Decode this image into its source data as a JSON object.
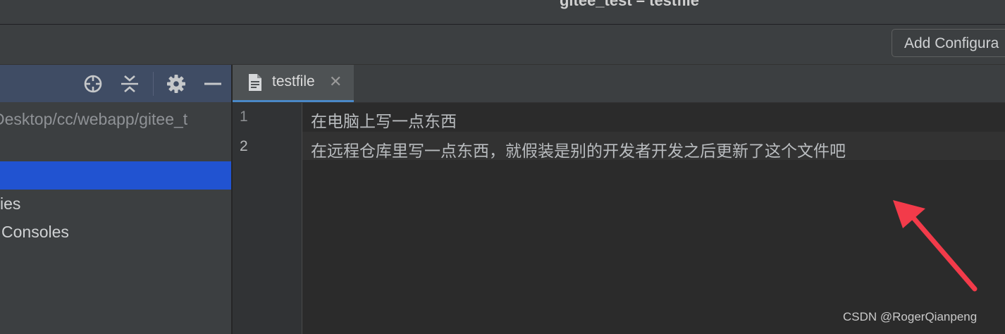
{
  "window": {
    "title": "gitee_test – testfile"
  },
  "toolbar": {
    "add_configuration_label": "Add Configura"
  },
  "project_panel": {
    "header_icons": [
      "crosshair-icon",
      "collapse-all-icon",
      "gear-icon",
      "minimize-icon"
    ],
    "tree": [
      {
        "label": "Desktop/cc/webapp/gitee_t"
      },
      {
        "label": ""
      },
      {
        "label": "",
        "selected": true
      },
      {
        "label": "ies"
      },
      {
        "label": "Consoles"
      }
    ]
  },
  "editor": {
    "tab": {
      "label": "testfile",
      "close": "✕"
    },
    "lines": [
      {
        "number": "1",
        "text": "在电脑上写一点东西"
      },
      {
        "number": "2",
        "text": "在远程仓库里写一点东西，就假装是别的开发者开发之后更新了这个文件吧"
      }
    ]
  },
  "annotation": {
    "arrow_color": "#f23b4a"
  },
  "watermark": {
    "text": "CSDN @RogerQianpeng"
  },
  "colors": {
    "selection": "#2153d1",
    "panel_header": "#3f4c64",
    "editor_background": "#2b2b2b"
  }
}
